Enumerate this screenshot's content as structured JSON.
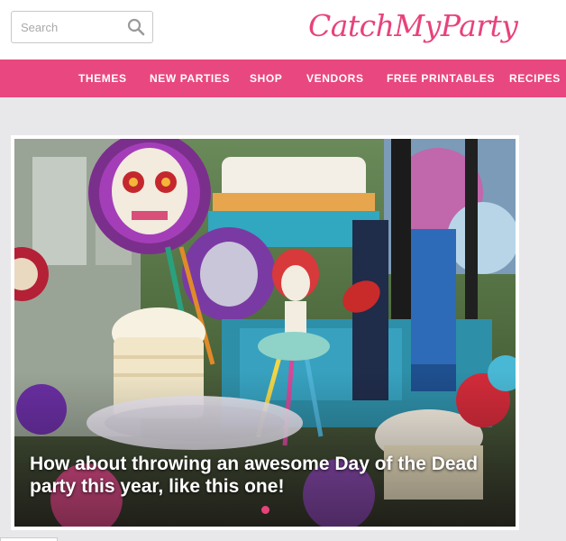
{
  "search": {
    "placeholder": "Search",
    "icon": "search-icon"
  },
  "logo": {
    "text": "CatchMyParty",
    "color": "#e8427c"
  },
  "nav": {
    "color": "#e8487f",
    "items": [
      {
        "label": "THEMES"
      },
      {
        "label": "NEW PARTIES"
      },
      {
        "label": "SHOP"
      },
      {
        "label": "VENDORS"
      },
      {
        "label": "FREE PRINTABLES"
      },
      {
        "label": "RECIPES"
      }
    ]
  },
  "hero": {
    "caption": "How about throwing an awesome Day of the Dead party this year, like this one!",
    "indicator_color": "#e8427c"
  }
}
